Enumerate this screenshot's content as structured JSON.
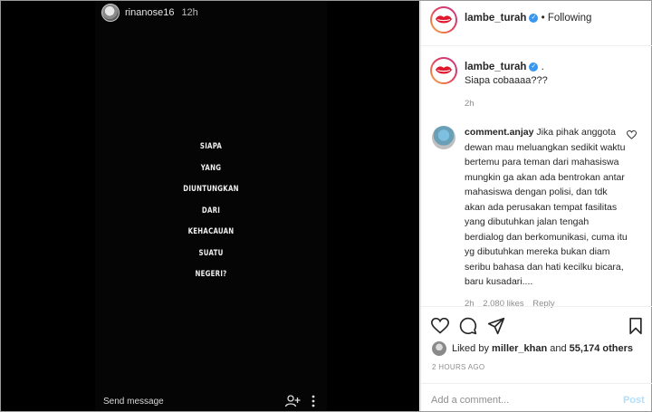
{
  "story": {
    "username": "rinanose16",
    "time": "12h",
    "lines": [
      "SIAPA",
      "YANG",
      "DIUNTUNGKAN",
      "DARI",
      "KEHACAUAN",
      "SUATU",
      "NEGERI?"
    ],
    "footer": "Send message",
    "icons": [
      "add-user-icon",
      "more-vertical-icon"
    ]
  },
  "post": {
    "username": "lambe_turah",
    "follow_sep": "•",
    "follow_status": "Following",
    "caption_suffix": ".",
    "caption": "Siapa cobaaaa???",
    "caption_time": "2h",
    "comment": {
      "username": "comment.anjay",
      "text": "Jika pihak anggota dewan mau meluangkan sedikit waktu bertemu para teman dari mahasiswa mungkin ga akan ada bentrokan antar mahasiswa dengan polisi, dan tdk akan ada perusakan tempat fasilitas yang dibutuhkan jalan tengah berdialog dan berkomunikasi, cuma itu yg dibutuhkan mereka bukan diam seribu bahasa dan hati kecilku bicara, baru kusadari....",
      "time": "2h",
      "likes": "2,080 likes",
      "reply": "Reply"
    },
    "liked_by_prefix": "Liked by",
    "liked_by_user": "miller_khan",
    "liked_by_and": "and",
    "liked_by_count": "55,174 others",
    "time_ago": "2 HOURS AGO",
    "comment_placeholder": "Add a comment...",
    "post_button": "Post"
  },
  "colors": {
    "accent": "#3897f0",
    "post_disabled": "#b2dffc",
    "muted": "#8e8e8e"
  }
}
